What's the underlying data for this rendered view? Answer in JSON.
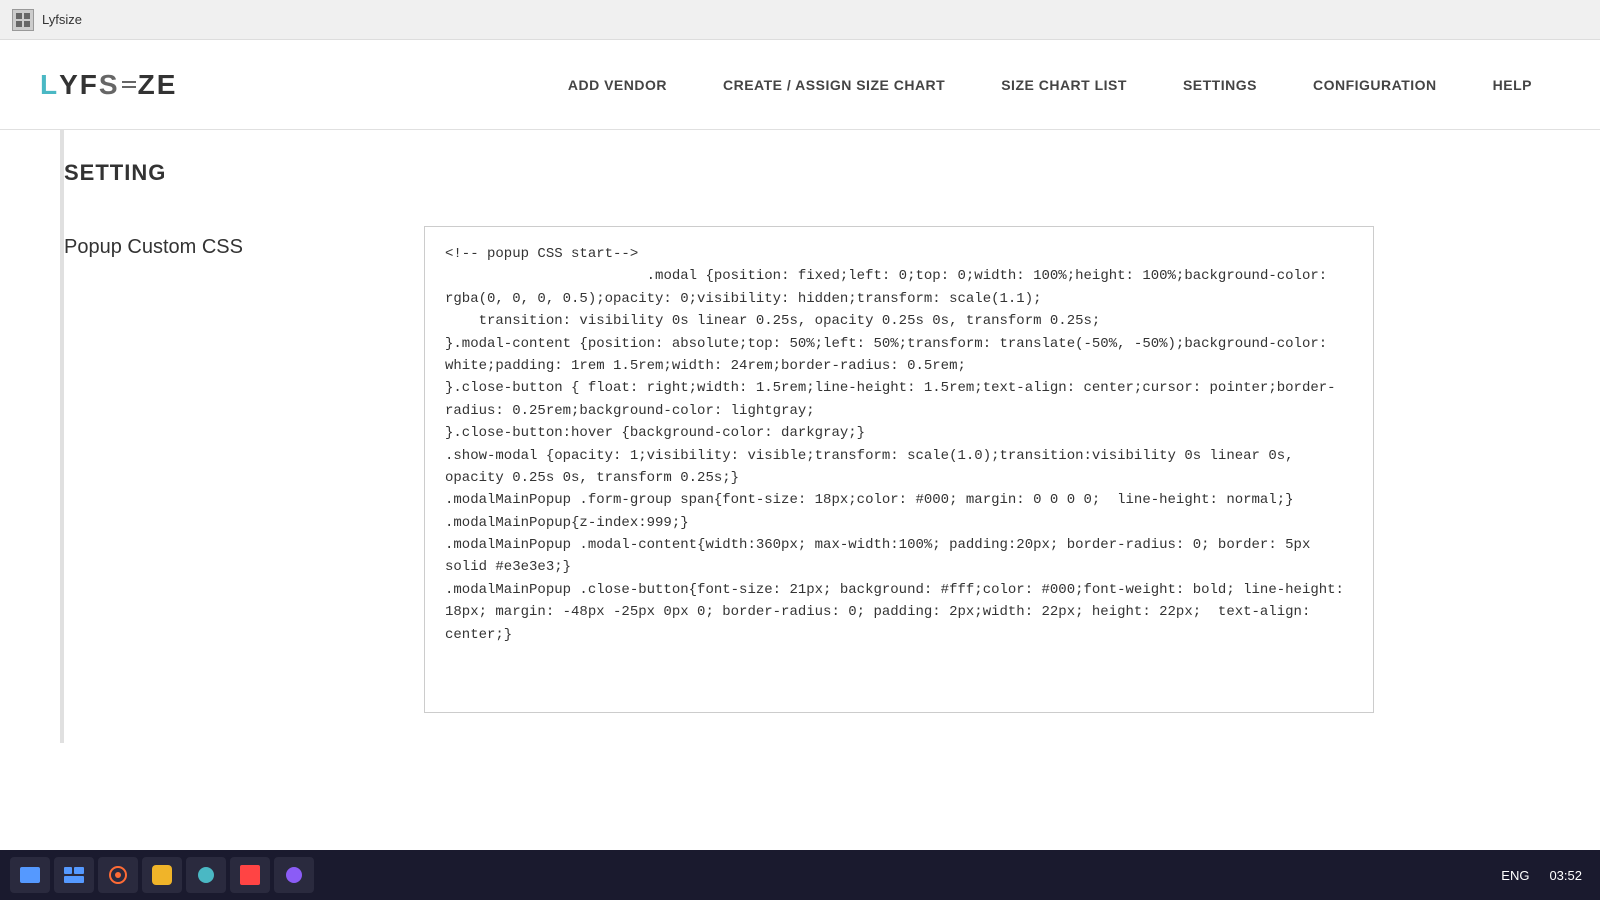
{
  "titleBar": {
    "appName": "Lyfsize"
  },
  "logo": {
    "letters": [
      "L",
      "Y",
      "F",
      "S",
      "Z",
      "E"
    ]
  },
  "nav": {
    "links": [
      {
        "id": "add-vendor",
        "label": "ADD VENDOR"
      },
      {
        "id": "create-assign",
        "label": "CREATE / ASSIGN SIZE CHART"
      },
      {
        "id": "size-chart-list",
        "label": "SIZE CHART LIST"
      },
      {
        "id": "settings",
        "label": "SETTINGS"
      },
      {
        "id": "configuration",
        "label": "CONFIGURATION"
      },
      {
        "id": "help",
        "label": "HELP"
      }
    ]
  },
  "main": {
    "sectionTitle": "SETTING",
    "rows": [
      {
        "label": "Popup Custom CSS",
        "cssContent": "<!-- popup CSS start-->\n.modal {position: fixed;left: 0;top: 0;width: 100%;height: 100%;background-color: rgba(0, 0, 0, 0.5);opacity: 0;visibility: hidden;transform: scale(1.1);\n    transition: visibility 0s linear 0.25s, opacity 0.25s 0s, transform 0.25s;\n}.modal-content {position: absolute;top: 50%;left: 50%;transform: translate(-50%, -50%);background-color: white;padding: 1rem 1.5rem;width: 24rem;border-radius: 0.5rem;\n}.close-button { float: right;width: 1.5rem;line-height: 1.5rem;text-align: center;cursor: pointer;border-radius: 0.25rem;background-color: lightgray;\n}.close-button:hover {background-color: darkgray;}\n.show-modal {opacity: 1;visibility: visible;transform: scale(1.0);transition:visibility 0s linear 0s, opacity 0.25s 0s, transform 0.25s;}\n.modalMainPopup .form-group span{font-size: 18px;color: #000; margin: 0 0 0 0;  line-height: normal;}\n.modalMainPopup{z-index:999;}\n.modalMainPopup .modal-content{width:360px; max-width:100%; padding:20px; border-radius: 0; border: 5px solid #e3e3e3;}\n.modalMainPopup .close-button{font-size: 21px; background: #fff;color: #000;font-weight: bold; line-height: 18px; margin: -48px -25px 0px 0; border-radius: 0; padding: 2px;width: 22px; height: 22px;  text-align: center;}"
      }
    ]
  },
  "taskbar": {
    "lang": "ENG",
    "clock": "03:52"
  }
}
